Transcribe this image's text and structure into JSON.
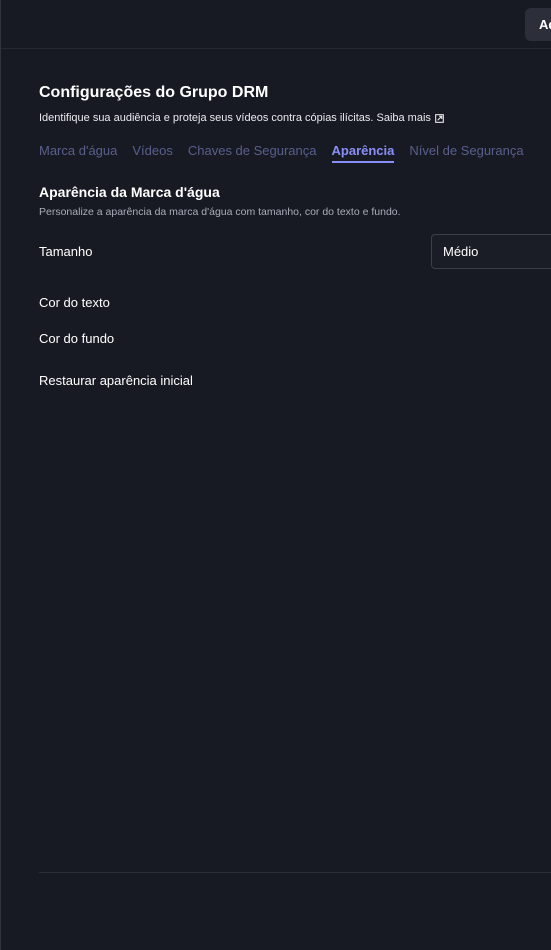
{
  "topbar": {
    "button_label": "Ad"
  },
  "header": {
    "title": "Configurações do Grupo DRM",
    "subtitle": "Identifique sua audiência e proteja seus vídeos contra cópias ilícitas.",
    "learn_more": "Saiba mais"
  },
  "tabs": [
    {
      "label": "Marca d'água",
      "active": false
    },
    {
      "label": "Vídeos",
      "active": false
    },
    {
      "label": "Chaves de Segurança",
      "active": false
    },
    {
      "label": "Aparência",
      "active": true
    },
    {
      "label": "Nível de Segurança",
      "active": false
    }
  ],
  "section": {
    "title": "Aparência da Marca d'água",
    "description": "Personalize a aparência da marca d'água com tamanho, cor do texto e fundo."
  },
  "settings": {
    "size_label": "Tamanho",
    "size_value": "Médio",
    "text_color_label": "Cor do texto",
    "background_color_label": "Cor do fundo",
    "reset_label": "Restaurar aparência inicial"
  },
  "colors": {
    "background": "#181a23",
    "accent": "#8a8ff8",
    "tab_inactive": "#5a5f8c"
  }
}
